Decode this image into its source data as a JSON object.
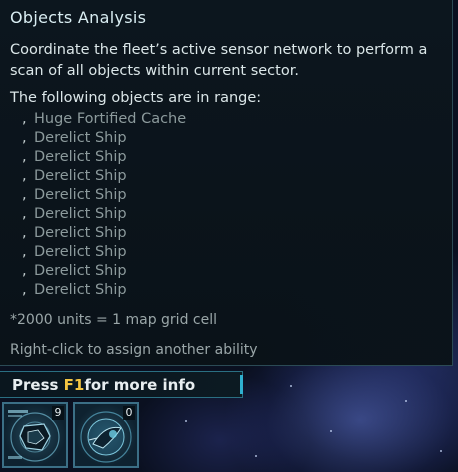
{
  "tooltip": {
    "title": "Objects Analysis",
    "description": "Coordinate the fleet’s active sensor network to perform a scan of all objects within current sector.",
    "range_header": "The following objects are in range:",
    "bullet": ",",
    "objects": [
      "Huge Fortified Cache",
      "Derelict Ship",
      "Derelict Ship",
      "Derelict Ship",
      "Derelict Ship",
      "Derelict Ship",
      "Derelict Ship",
      "Derelict Ship",
      "Derelict Ship",
      "Derelict Ship"
    ],
    "footnote": "*2000 units = 1 map grid cell",
    "hint": "Right-click to assign another ability"
  },
  "f1_bar": {
    "prefix": "Press ",
    "key": "F1",
    "suffix": "for more info"
  },
  "ability_slots": [
    {
      "icon": "sensor-scan-icon",
      "count": "9"
    },
    {
      "icon": "ship-scan-icon",
      "count": "0"
    }
  ],
  "colors": {
    "key_highlight": "#f4c542",
    "panel_border": "#2a6f82",
    "object_text": "#8c9a9c"
  }
}
